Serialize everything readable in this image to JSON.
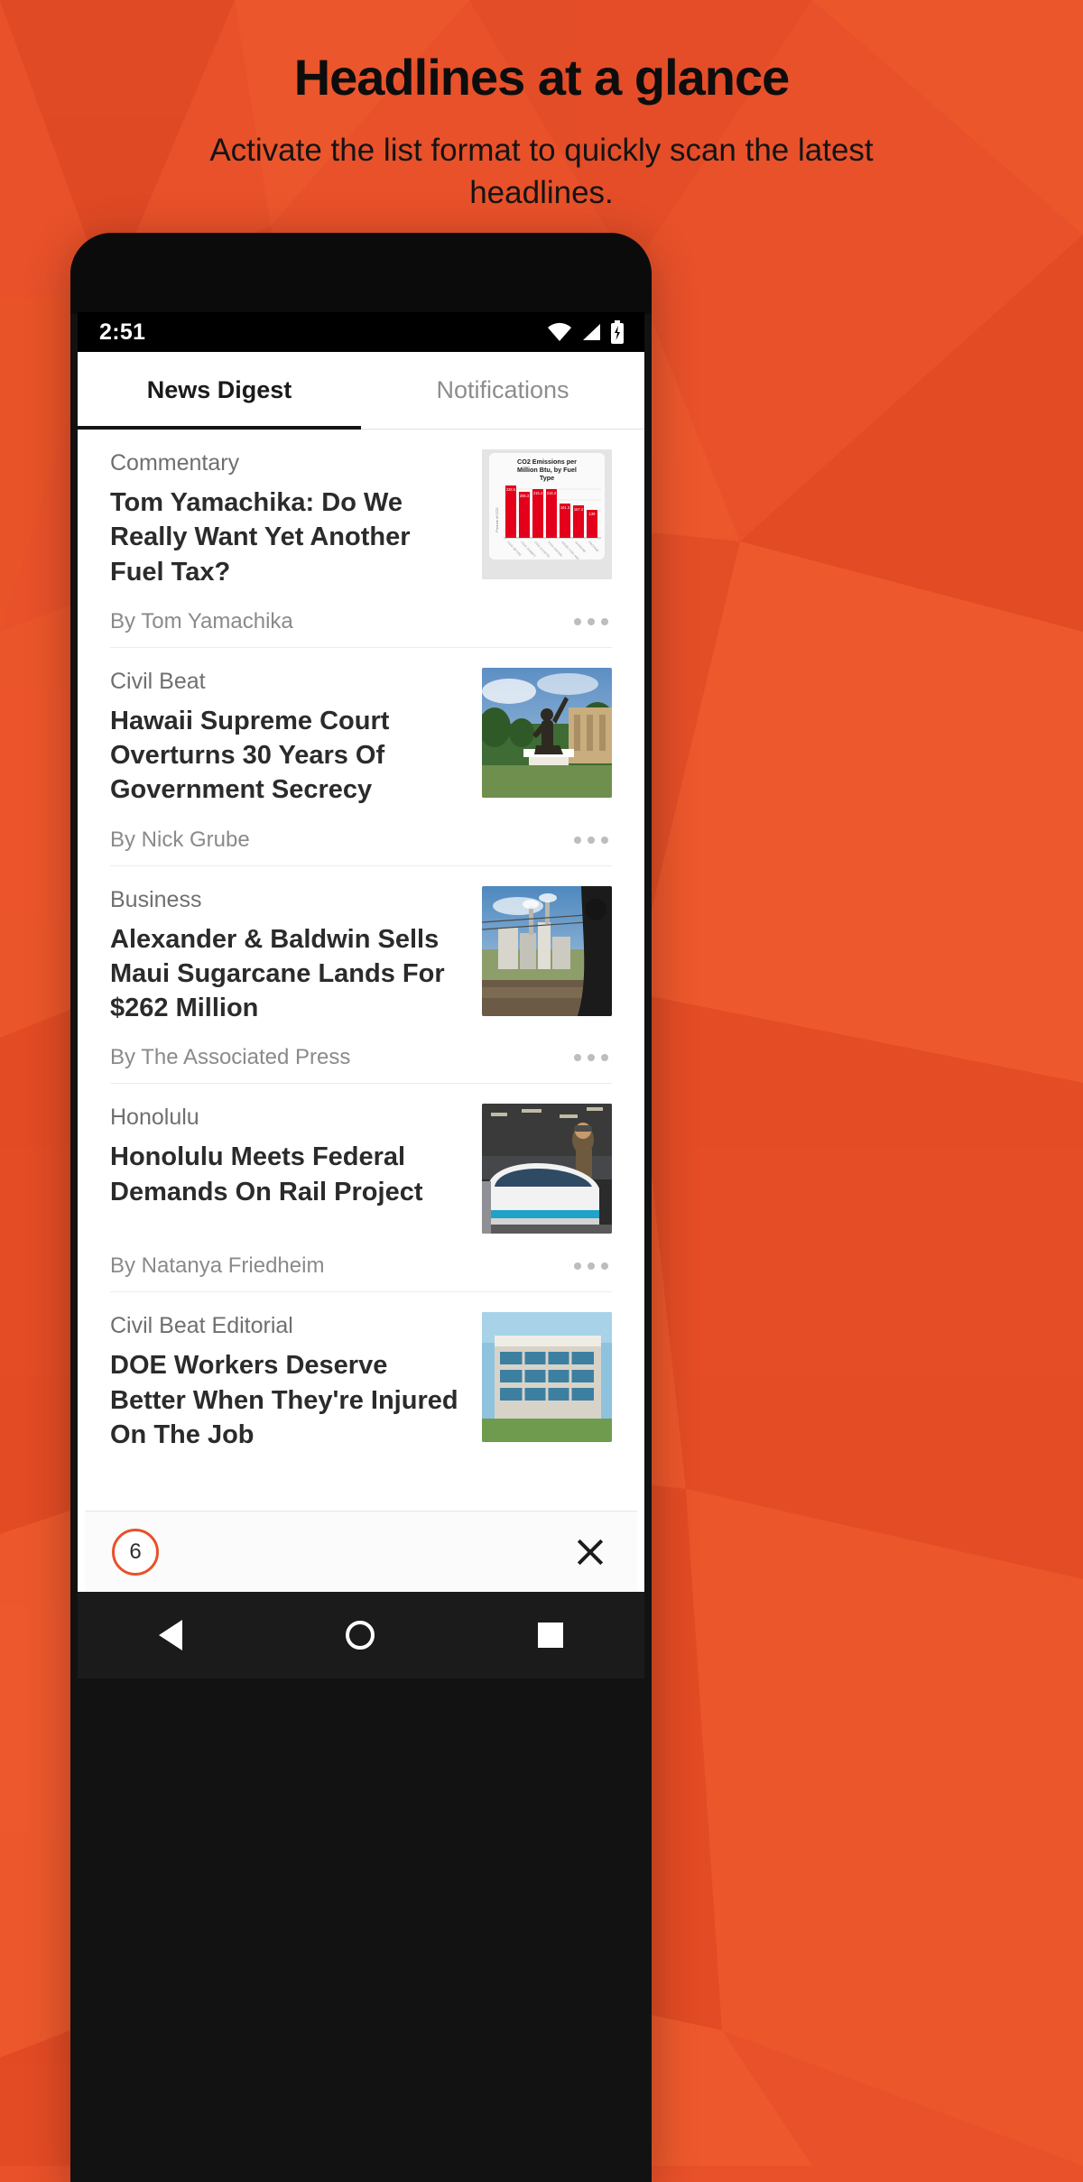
{
  "promo": {
    "title": "Headlines at a glance",
    "subtitle": "Activate the list format to quickly scan the latest headlines."
  },
  "theme": {
    "background": "#E8512A",
    "accent": "#E8512A",
    "text_dark": "#0d0d0d"
  },
  "phone": {
    "statusbar": {
      "time": "2:51",
      "icons": [
        "wifi-icon",
        "signal-icon",
        "battery-charging-icon"
      ]
    },
    "navbar": {
      "items": [
        "back-button",
        "home-button",
        "recents-button"
      ]
    }
  },
  "app": {
    "tabs": [
      {
        "label": "News Digest",
        "active": true
      },
      {
        "label": "Notifications",
        "active": false
      }
    ],
    "articles": [
      {
        "kicker": "Commentary",
        "headline": "Tom Yamachika: Do We Really Want Yet Another Fuel Tax?",
        "byline": "By Tom Yamachika",
        "thumb": "chart-thumbnail"
      },
      {
        "kicker": "Civil Beat",
        "headline": "Hawaii Supreme Court Overturns 30 Years Of Government Secrecy",
        "byline": "By Nick Grube",
        "thumb": "statue-photo-thumbnail"
      },
      {
        "kicker": "Business",
        "headline": "Alexander & Baldwin Sells Maui Sugarcane Lands For $262 Million",
        "byline": "By The Associated Press",
        "thumb": "industrial-plant-photo-thumbnail"
      },
      {
        "kicker": "Honolulu",
        "headline": "Honolulu Meets Federal Demands On Rail Project",
        "byline": "By Natanya Friedheim",
        "thumb": "rail-car-photo-thumbnail"
      },
      {
        "kicker": "Civil Beat Editorial",
        "headline": "DOE Workers Deserve Better When They're Injured On The Job",
        "byline": "",
        "thumb": "building-photo-thumbnail"
      }
    ],
    "bottom_bar": {
      "count": "6",
      "close_label": "×"
    }
  },
  "chart_data": {
    "type": "bar",
    "title": "CO2 Emissions per Million Btu, by Fuel Type",
    "xlabel": "",
    "ylabel": "Pounds of CO2",
    "categories": [
      "COAL (BITUMINOUS)",
      "COAL (SUBBITUMINOUS)",
      "COAL (LIGNITE)",
      "COAL (ANTHRACITE)",
      "DIESEL FUEL AND HEATING OIL",
      "GASOLINE",
      "PROPANE"
    ],
    "values": [
      228.6,
      205.3,
      215.4,
      216.3,
      161.3,
      157.2,
      139
    ],
    "value_labels": [
      "228.6",
      "205.3",
      "215.4",
      "216.3",
      "161.3",
      "157.2",
      "139"
    ],
    "ylim": [
      0,
      250
    ],
    "bar_color": "#E4001B",
    "grid": true,
    "legend": false
  }
}
